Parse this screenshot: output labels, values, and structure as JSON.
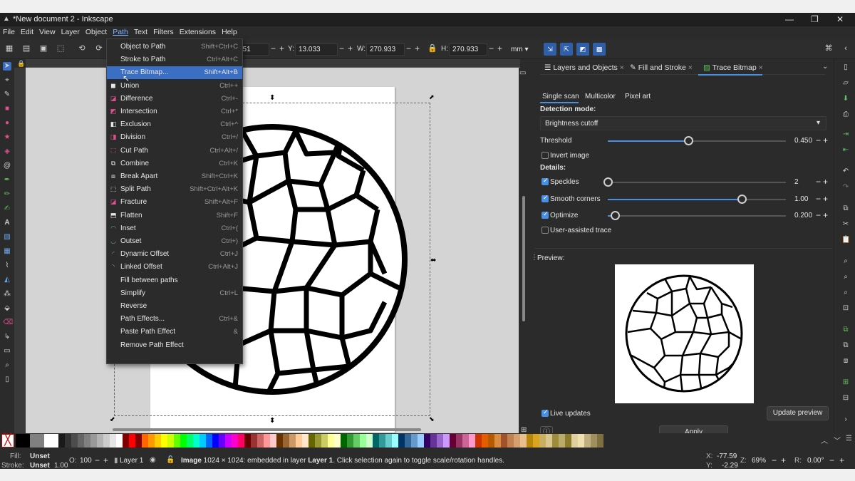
{
  "window": {
    "title": "*New document 2 - Inkscape"
  },
  "menubar": [
    "File",
    "Edit",
    "View",
    "Layer",
    "Object",
    "Path",
    "Text",
    "Filters",
    "Extensions",
    "Help"
  ],
  "toolbar": {
    "x_value": "351",
    "y_label": "Y:",
    "y_value": "13.033",
    "w_label": "W:",
    "w_value": "270.933",
    "h_label": "H:",
    "h_value": "270.933",
    "unit": "mm"
  },
  "path_menu": [
    {
      "label": "Object to Path",
      "shortcut": "Shift+Ctrl+C",
      "icon": ""
    },
    {
      "label": "Stroke to Path",
      "shortcut": "Ctrl+Alt+C",
      "icon": ""
    },
    {
      "label": "Trace Bitmap...",
      "shortcut": "Shift+Alt+B",
      "icon": "",
      "highlighted": true
    },
    {
      "label": "Union",
      "shortcut": "Ctrl++",
      "icon": "union-icon"
    },
    {
      "label": "Difference",
      "shortcut": "Ctrl+-",
      "icon": "difference-icon"
    },
    {
      "label": "Intersection",
      "shortcut": "Ctrl+*",
      "icon": "intersection-icon"
    },
    {
      "label": "Exclusion",
      "shortcut": "Ctrl+^",
      "icon": "exclusion-icon"
    },
    {
      "label": "Division",
      "shortcut": "Ctrl+/",
      "icon": "division-icon"
    },
    {
      "label": "Cut Path",
      "shortcut": "Ctrl+Alt+/",
      "icon": "cut-path-icon"
    },
    {
      "label": "Combine",
      "shortcut": "Ctrl+K",
      "icon": "combine-icon"
    },
    {
      "label": "Break Apart",
      "shortcut": "Shift+Ctrl+K",
      "icon": "break-apart-icon"
    },
    {
      "label": "Split Path",
      "shortcut": "Shift+Ctrl+Alt+K",
      "icon": "split-path-icon"
    },
    {
      "label": "Fracture",
      "shortcut": "Shift+Alt+F",
      "icon": "fracture-icon"
    },
    {
      "label": "Flatten",
      "shortcut": "Shift+F",
      "icon": "flatten-icon"
    },
    {
      "label": "Inset",
      "shortcut": "Ctrl+(",
      "icon": "inset-icon"
    },
    {
      "label": "Outset",
      "shortcut": "Ctrl+)",
      "icon": "outset-icon"
    },
    {
      "label": "Dynamic Offset",
      "shortcut": "Ctrl+J",
      "icon": "dynamic-offset-icon"
    },
    {
      "label": "Linked Offset",
      "shortcut": "Ctrl+Alt+J",
      "icon": "linked-offset-icon"
    },
    {
      "label": "Fill between paths",
      "shortcut": "",
      "icon": ""
    },
    {
      "label": "Simplify",
      "shortcut": "Ctrl+L",
      "icon": ""
    },
    {
      "label": "Reverse",
      "shortcut": "",
      "icon": ""
    },
    {
      "label": "Path Effects...",
      "shortcut": "Ctrl+&",
      "icon": ""
    },
    {
      "label": "Paste Path Effect",
      "shortcut": "&",
      "icon": ""
    },
    {
      "label": "Remove Path Effect",
      "shortcut": "",
      "icon": ""
    }
  ],
  "dock": {
    "tabs": [
      "Layers and Objects",
      "Fill and Stroke",
      "Trace Bitmap"
    ],
    "subtabs": [
      "Single scan",
      "Multicolor",
      "Pixel art"
    ],
    "detection_mode_label": "Detection mode:",
    "detection_mode_value": "Brightness cutoff",
    "threshold_label": "Threshold",
    "threshold_value": "0.450",
    "threshold_fraction": 0.45,
    "invert_label": "Invert image",
    "invert_checked": false,
    "details_label": "Details:",
    "speckles_label": "Speckles",
    "speckles_value": "2",
    "speckles_fraction": 0.0,
    "smooth_label": "Smooth corners",
    "smooth_value": "1.00",
    "smooth_fraction": 0.75,
    "optimize_label": "Optimize",
    "optimize_value": "0.200",
    "optimize_fraction": 0.04,
    "user_assisted_label": "User-assisted trace",
    "preview_label": "Preview:",
    "live_updates_label": "Live updates",
    "update_preview_label": "Update preview",
    "apply_label": "Apply"
  },
  "status": {
    "fill_label": "Fill:",
    "fill_value": "Unset",
    "stroke_label": "Stroke:",
    "stroke_value": "Unset",
    "stroke_width": "1.00",
    "opacity_label": "O:",
    "opacity_value": "100",
    "layer": "Layer 1",
    "message_bold": "Image",
    "message": " 1024 × 1024: embedded in layer ",
    "message_layer": "Layer 1",
    "message_tail": ". Click selection again to toggle scale/rotation handles.",
    "x_label": "X:",
    "x_value": "-77.59",
    "y_label": "Y:",
    "y_value": "-2.29",
    "zoom_label": "Z:",
    "zoom_value": "69%",
    "rotation_label": "R:",
    "rotation_value": "0.00°"
  },
  "palette": [
    "#000000",
    "#808080",
    "#ffffff",
    "#1a1a1a",
    "#333333",
    "#4d4d4d",
    "#666666",
    "#808080",
    "#999999",
    "#b3b3b3",
    "#cccccc",
    "#e6e6e6",
    "#ffffff",
    "#800000",
    "#ff0000",
    "#800000",
    "#ff6600",
    "#ff9900",
    "#ffcc00",
    "#ffff00",
    "#ccff00",
    "#66ff00",
    "#00ff00",
    "#00ff66",
    "#00ffcc",
    "#00ccff",
    "#0066ff",
    "#0000ff",
    "#6600ff",
    "#cc00ff",
    "#ff00cc",
    "#ff0066",
    "#660000",
    "#993333",
    "#cc6666",
    "#ff9999",
    "#ffcccc",
    "#663300",
    "#996633",
    "#cc9966",
    "#ffcc99",
    "#ffe6cc",
    "#666600",
    "#999933",
    "#cccc66",
    "#ffff99",
    "#ffffcc",
    "#006600",
    "#339933",
    "#66cc66",
    "#99ff99",
    "#ccffcc",
    "#006666",
    "#339999",
    "#66cccc",
    "#99ffff",
    "#003366",
    "#336699",
    "#6699cc",
    "#99ccff",
    "#330066",
    "#663399",
    "#9966cc",
    "#cc99ff",
    "#660033",
    "#993366",
    "#cc6699",
    "#ff99cc",
    "#cc3300",
    "#e65c00",
    "#b35900",
    "#d98c3f",
    "#a0522d",
    "#c08050",
    "#d4a070",
    "#e8c090",
    "#b8860b",
    "#daa520",
    "#c8b060",
    "#d8c890",
    "#9c8c3c",
    "#bcac6c",
    "#8c7c2c",
    "#e0d0a0",
    "#f0e0b0",
    "#c0b080",
    "#a09060",
    "#807040"
  ]
}
